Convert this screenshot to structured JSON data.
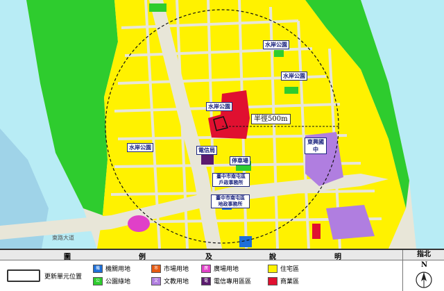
{
  "radius_label": "半徑500m",
  "map_labels": {
    "water_park_1": "水岸公園",
    "water_park_2": "水岸公園",
    "water_park_3": "水岸公園",
    "water_park_4": "水岸公園",
    "telecom": "電信局",
    "school": "東興國中",
    "market": "停車場",
    "office_1": "臺中市南屯區\n戶政事務所",
    "office_2": "臺中市南屯區\n地政事務所"
  },
  "road_labels": {
    "bottom_left": "東路大道"
  },
  "legend": {
    "header_chars": [
      "圖",
      "例",
      "及",
      "說",
      "明"
    ],
    "compass_title": "指北",
    "compass_letter": "N",
    "renewal_label": "更新單元位置",
    "items": [
      {
        "label": "機關用地",
        "color": "#1e6fd9",
        "mark": "機"
      },
      {
        "label": "公園綠地",
        "color": "#2ecc2e",
        "mark": "公"
      },
      {
        "label": "市場用地",
        "color": "#e65a12",
        "mark": "市"
      },
      {
        "label": "文教用地",
        "color": "#b07ee0",
        "mark": "文"
      },
      {
        "label": "廣場用地",
        "color": "#e040c8",
        "mark": "廣"
      },
      {
        "label": "電信專用區區",
        "color": "#5a1a6e",
        "mark": "電"
      },
      {
        "label": "住宅區",
        "color": "#fff200",
        "mark": ""
      },
      {
        "label": "商業區",
        "color": "#e01030",
        "mark": ""
      }
    ]
  },
  "colors": {
    "residential": "#fff200",
    "commercial": "#e01030",
    "park": "#2ecc2e",
    "river": "#b8ecf5",
    "sea": "#9fd3e8",
    "education": "#b07ee0",
    "government": "#1e6fd9",
    "road": "#e8e6d8"
  }
}
